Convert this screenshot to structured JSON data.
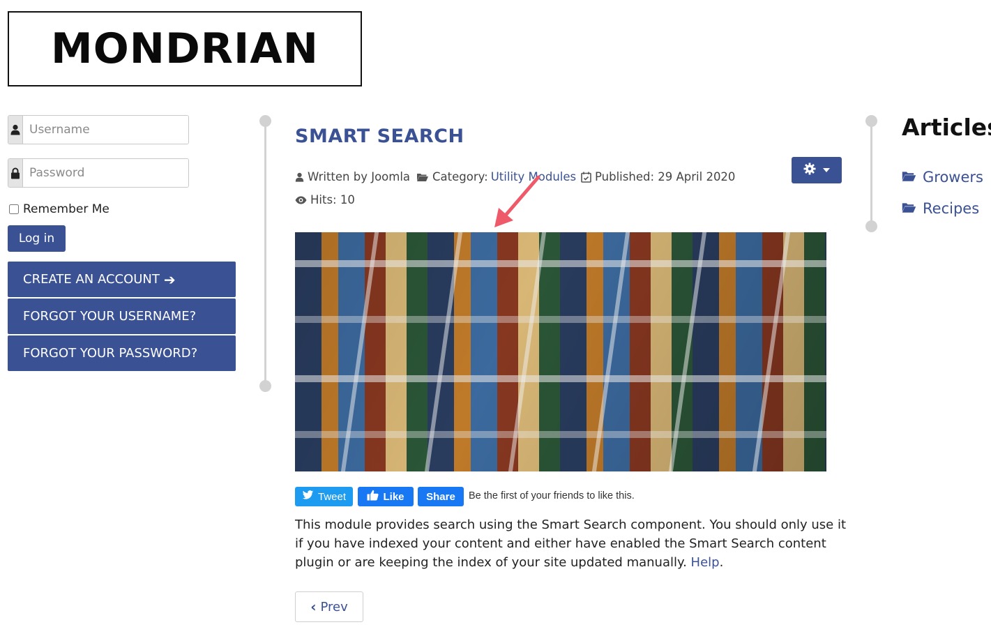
{
  "logo": {
    "text": "MONDRIAN"
  },
  "login": {
    "username_placeholder": "Username",
    "password_placeholder": "Password",
    "remember_label": "Remember Me",
    "login_label": "Log in",
    "create_account": "CREATE AN ACCOUNT",
    "forgot_username": "FORGOT YOUR USERNAME?",
    "forgot_password": "FORGOT YOUR PASSWORD?"
  },
  "article": {
    "title": "SMART SEARCH",
    "author": "Written by Joomla",
    "category_label": "Category:",
    "category_value": "Utility Modules",
    "published": "Published: 29 April 2020",
    "hits": "Hits: 10",
    "body": "This module provides search using the Smart Search component. You should only use it if you have indexed your content and either have enabled the Smart Search content plugin or are keeping the index of your site updated manually.",
    "help_link": "Help",
    "body_end": ".",
    "prev_label": "Prev"
  },
  "social": {
    "tweet": "Tweet",
    "like": "Like",
    "share": "Share",
    "fb_text": "Be the first of your friends to like this."
  },
  "sidebar_right": {
    "heading": "Articles",
    "links": [
      "Growers",
      "Recipes"
    ]
  },
  "colors": {
    "accent": "#3a5193",
    "twitter": "#1d9bf0",
    "facebook": "#1877f2",
    "annotation": "#ee5a6a"
  }
}
